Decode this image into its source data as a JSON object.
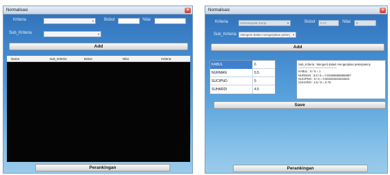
{
  "left": {
    "title": "Normalisasi",
    "labels": {
      "kriteria": "Kriteria",
      "bobot": "Bobot",
      "nilai": "Nilai",
      "sub_kriteria": "Sub_Kriteria"
    },
    "add_label": "Add",
    "columns": [
      "Nama",
      "Sub_Kriteria",
      "Bobot",
      "Nilai",
      "Kriteria"
    ],
    "rank_label": "Perankingan"
  },
  "right": {
    "title": "Normalisasi",
    "labels": {
      "kriteria": "Kriteria",
      "bobot": "Bobot",
      "nilai": "Nilai",
      "sub_kriteria": "Sub_Kriteria"
    },
    "kriteria_value": "Kemampuan Kerja",
    "sub_kriteria_value": "Mengerti dalam mengerjakan pekerj",
    "bobot_value": "0.17",
    "nilai_value": "6",
    "add_label": "Add",
    "rows": [
      {
        "name": "KABUL",
        "value": "6"
      },
      {
        "name": "NURMAN",
        "value": "5.5"
      },
      {
        "name": "SUCIPNO",
        "value": "5"
      },
      {
        "name": "SUHARDI",
        "value": "4.5"
      }
    ],
    "result_lines": [
      "Sub_Kriteria : Mengerti dalam mengerjakan pekerjaanny",
      "----------------------------------------",
      "KABUL : 6 / 6 = 1",
      "NURMAN : 5.5 / 6 = 0.916666666666667",
      "SUCIPNO : 5 / 6 = 0.833333333333333",
      "SUHARDI : 4.5 / 6 = 0.75"
    ],
    "save_label": "Save",
    "rank_label": "Perankingan"
  },
  "colors": {
    "window_top": "#2f6fb8",
    "window_bottom": "#9ccbea",
    "selected_row": "#3f7fd0",
    "close_button": "#c9382a"
  },
  "icons": {
    "close": "close-icon",
    "dropdown": "chevron-down-icon"
  }
}
